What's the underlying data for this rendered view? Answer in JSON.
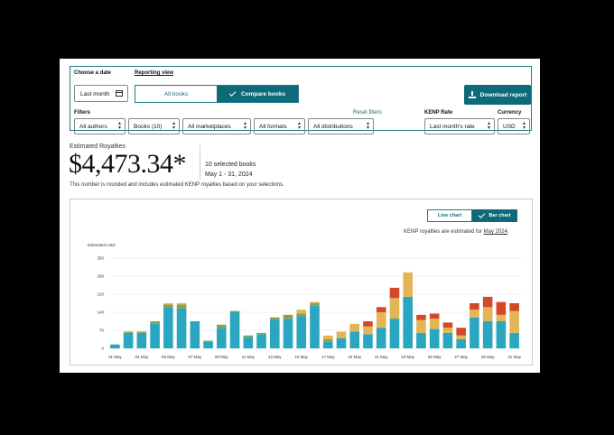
{
  "filters": {
    "date_label": "Choose a date",
    "date_value": "Last month",
    "reporting_label": "Reporting view",
    "view_all": "All books",
    "view_compare": "Compare books",
    "download": "Download report",
    "filters_label": "Filters",
    "reset": "Reset filters",
    "kenp_label": "KENP Rate",
    "currency_label": "Currency",
    "authors": "All authors",
    "books": "Books (10)",
    "marketplaces": "All marketplaces",
    "formats": "All formats",
    "distributions": "All distributions",
    "kenp_value": "Last month's rate",
    "currency_value": "USD"
  },
  "summary": {
    "label": "Estimated Royalties",
    "amount": "$4,473.34*",
    "selected": "10 selected books",
    "dates": "May 1 - 31, 2024",
    "note": "This number is rounded and includes estimated KENP royalties based on your selections."
  },
  "chart_ui": {
    "line_btn": "Line chart",
    "bar_btn": "Bar chart",
    "kenp_note": "KENP royalties are estimated for",
    "kenp_month": "May 2024",
    "kenp_end": "."
  },
  "colors": {
    "teal": "#2aa6c0",
    "green": "#8aa04a",
    "yellow": "#e3b554",
    "red": "#d2492a"
  },
  "chart_data": {
    "type": "bar",
    "stacked": true,
    "ylabel": "Estimated USD",
    "yticks": [
      0,
      70,
      140,
      210,
      280,
      350
    ],
    "ylim": [
      0,
      350
    ],
    "xtick_labels": [
      "01 May",
      "03 May",
      "05 May",
      "07 May",
      "09 May",
      "11 May",
      "13 May",
      "15 May",
      "17 May",
      "19 May",
      "21 May",
      "23 May",
      "25 May",
      "27 May",
      "29 May",
      "31 May"
    ],
    "categories": [
      "1",
      "2",
      "3",
      "4",
      "5",
      "6",
      "7",
      "8",
      "9",
      "10",
      "11",
      "12",
      "13",
      "14",
      "15",
      "16",
      "17",
      "18",
      "19",
      "20",
      "21",
      "22",
      "23",
      "24",
      "25",
      "26",
      "27",
      "28",
      "29",
      "30",
      "31"
    ],
    "series": [
      {
        "color": "#2aa6c0",
        "values": [
          15,
          60,
          60,
          95,
          160,
          155,
          105,
          25,
          80,
          140,
          45,
          55,
          110,
          115,
          125,
          165,
          25,
          40,
          65,
          55,
          80,
          115,
          200,
          60,
          75,
          60,
          35,
          120,
          105,
          105,
          60
        ]
      },
      {
        "color": "#8aa04a",
        "values": [
          0,
          5,
          5,
          10,
          10,
          15,
          0,
          5,
          12,
          5,
          5,
          5,
          10,
          15,
          10,
          10,
          10,
          0,
          0,
          0,
          0,
          0,
          0,
          0,
          0,
          0,
          0,
          0,
          0,
          0,
          0
        ]
      },
      {
        "color": "#e3b554",
        "values": [
          0,
          0,
          0,
          0,
          5,
          5,
          0,
          0,
          0,
          0,
          0,
          0,
          0,
          0,
          15,
          5,
          15,
          25,
          30,
          30,
          60,
          80,
          95,
          50,
          40,
          20,
          15,
          30,
          55,
          25,
          85
        ]
      },
      {
        "color": "#d2492a",
        "values": [
          0,
          0,
          0,
          0,
          0,
          0,
          0,
          0,
          0,
          0,
          0,
          0,
          0,
          0,
          0,
          0,
          0,
          0,
          0,
          20,
          20,
          40,
          0,
          20,
          20,
          20,
          30,
          25,
          40,
          50,
          30
        ]
      }
    ]
  }
}
